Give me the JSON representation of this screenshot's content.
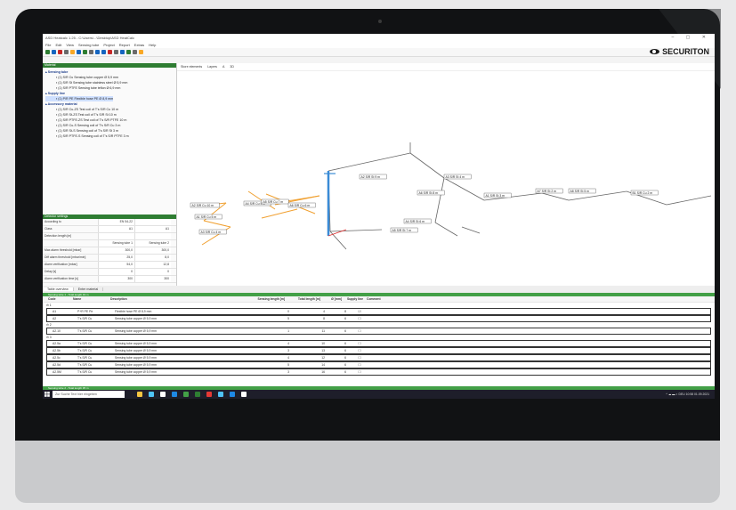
{
  "app": {
    "title": "ASD Heatcalc 1.25 - C:\\Users\\...\\Desktop\\ASD HeatCalc",
    "menu": [
      "File",
      "Edit",
      "View",
      "Sensing tube",
      "Project",
      "Report",
      "Extras",
      "Help"
    ],
    "window_controls": "–  ▢  ✕",
    "brand": "SECURITON"
  },
  "left": {
    "material_header": "Material",
    "groups": [
      {
        "name": "Sensing tube",
        "items": [
          "(1) S/R Cu Sensing tube copper Ø 5,9 mm",
          "(1) S/R St Sensing tube stainless steel Ø 5,9 mm",
          "(1) S/R PTFE Sensing tube teflon Ø 6,9 mm"
        ]
      },
      {
        "name": "Supply line",
        "items": [
          "(1) P/R PE Flexible hose PE Ø 8,9 mm"
        ]
      },
      {
        "name": "Accessory material",
        "items": [
          "(1) S/R Cu-ZS Test coil of T's S/R Cu 10 m",
          "(1) S/R St-ZS Test coil of T's S/R St 10 m",
          "(1) S/R PTFE-ZS Test coil of T's S/R PTFE 10 m",
          "(1) S/R Cu-S Sensing coil of T's S/R Cu 3 m",
          "(1) S/R St-S Sensing coil of T's S/R St 3 m",
          "(1) S/R PTFE-S Sensing coil of T's S/R PTFE 3 m"
        ]
      }
    ],
    "selected_item": "(1) P/R PE Flexible hose PE Ø 8,9 mm",
    "detector_header": "Detector settings",
    "props": [
      {
        "label": "According to",
        "v1": "EN 54-22",
        "v2": ""
      },
      {
        "label": "Class",
        "v1": "A1",
        "v2": "A1"
      },
      {
        "label": "Detection length [m]",
        "v1": "",
        "v2": ""
      },
      {
        "label": "",
        "v1": "Sensing tube 1",
        "v2": "Sensing tube 2"
      },
      {
        "label": "Max alarm threshold [mbar]",
        "v1": "300,0",
        "v2": "300,0"
      },
      {
        "label": "Diff alarm threshold [mbar/min]",
        "v1": "25,0",
        "v2": "8,0"
      },
      {
        "label": "Alarm verification [mbar]",
        "v1": "54,0",
        "v2": "12,8"
      },
      {
        "label": "Delay [s]",
        "v1": "0",
        "v2": "0"
      },
      {
        "label": "Alarm verification time [s]",
        "v1": "300",
        "v2": "300"
      }
    ]
  },
  "viewport": {
    "toolbar": [
      "Store elements",
      "Layers",
      "A",
      "3D"
    ],
    "labels": [
      "A2 S/R Cu 10 m",
      "A1 S/R Cu 5 m",
      "A3 S/R Cu 4 m",
      "A4 S/R Cu 5 m",
      "A5 S/R Cu 7 m",
      "A6 S/R Cu 6 m",
      "A2 S/R St 9 m",
      "A3 S/R St 4 m",
      "A1 S/R St 3 m",
      "A4 S/R St 6 m",
      "A5 S/R St 7 m",
      "A6 S/R St 8 m",
      "A7 S/R St 2 m",
      "A8 S/R St 5 m",
      "B1 S/R Cu 2 m"
    ]
  },
  "tabs": [
    "Table overview",
    "Enter material"
  ],
  "table": {
    "strip_label": "Sensing tube 1 - Total length 19 m",
    "columns": [
      "Code",
      "Name",
      "Description",
      "Sensing length [m]",
      "Total length [m]",
      "Ø [mm]",
      "Supply line",
      "Comment"
    ],
    "sections": [
      {
        "mark": "1",
        "rows": [
          {
            "code": "A1",
            "name": "P+R PE Pe",
            "desc": "Flexible hose PE Ø 8,9 mm",
            "len": "0",
            "total": "4",
            "dia": "8",
            "supply": "☑"
          },
          {
            "code": "A2",
            "name": "T's S/R Cu",
            "desc": "Sensing tube copper Ø 5,9 mm",
            "len": "5",
            "total": "8",
            "dia": "6",
            "supply": "☐"
          }
        ]
      },
      {
        "mark": "2",
        "rows": [
          {
            "code": "A2.10",
            "name": "T's S/R Cu",
            "desc": "Sensing tube copper Ø 5,9 mm",
            "len": "1",
            "total": "11",
            "dia": "6",
            "supply": "☐"
          }
        ]
      },
      {
        "mark": "3",
        "rows": [
          {
            "code": "A2.5a",
            "name": "T's S/R Cu",
            "desc": "Sensing tube copper Ø 5,9 mm",
            "len": "4",
            "total": "10",
            "dia": "6",
            "supply": "☐"
          },
          {
            "code": "A2.5b",
            "name": "T's S/R Cu",
            "desc": "Sensing tube copper Ø 5,9 mm",
            "len": "3",
            "total": "13",
            "dia": "6",
            "supply": "☐"
          },
          {
            "code": "A2.5c",
            "name": "T's S/R Cu",
            "desc": "Sensing tube copper Ø 5,9 mm",
            "len": "4",
            "total": "12",
            "dia": "6",
            "supply": "☐"
          },
          {
            "code": "A2.5d",
            "name": "T's S/R Cu",
            "desc": "Sensing tube copper Ø 5,9 mm",
            "len": "5",
            "total": "14",
            "dia": "6",
            "supply": "☐"
          },
          {
            "code": "A2.5M",
            "name": "T's S/R Cu",
            "desc": "Sensing tube copper Ø 5,9 mm",
            "len": "3",
            "total": "16",
            "dia": "6",
            "supply": "☐"
          }
        ]
      }
    ],
    "footer_label": "Sensing tube 2 - Total length 35 m"
  },
  "taskbar": {
    "search_placeholder": "Zur Suche Text hier eingeben",
    "tray": "^  ☁  ▬  ◐  DEU  10:58  01.09.2021"
  },
  "colors": {
    "accent_green": "#2e7d32",
    "pipe_orange": "#f0a030",
    "pipe_blue": "#3a8bd6",
    "pipe_gray": "#666666",
    "axis_red": "#e03030"
  }
}
